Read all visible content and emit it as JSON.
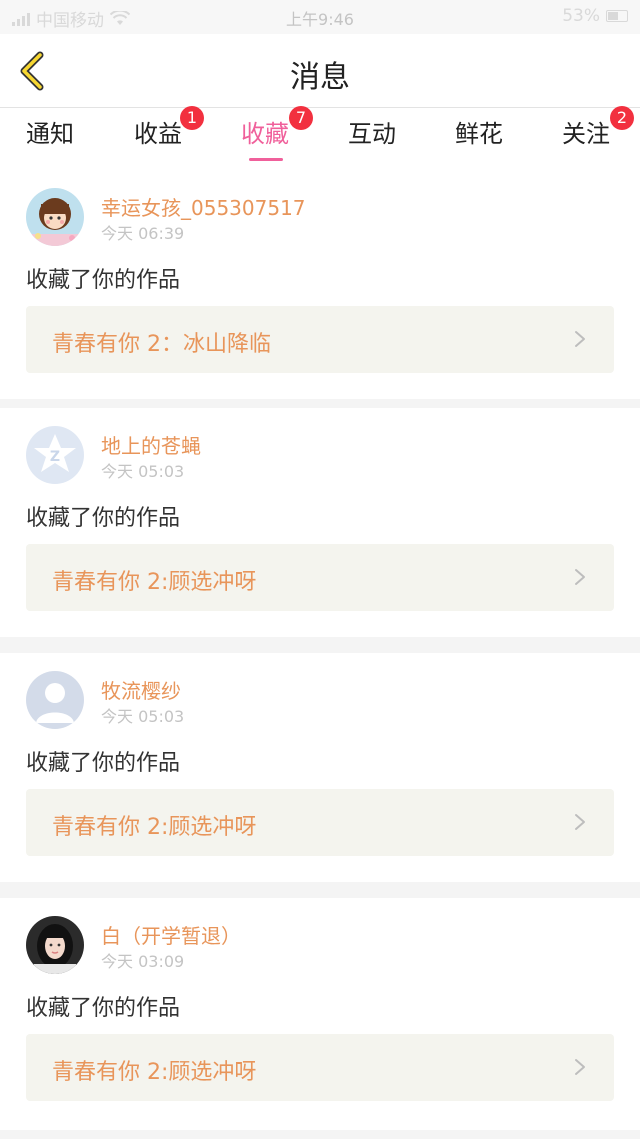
{
  "status_bar": {
    "carrier": "中国移动",
    "time": "上午9:46",
    "battery": "53%"
  },
  "header": {
    "title": "消息"
  },
  "tabs": [
    {
      "label": "通知",
      "badge": ""
    },
    {
      "label": "收益",
      "badge": "1"
    },
    {
      "label": "收藏",
      "badge": "7"
    },
    {
      "label": "互动",
      "badge": ""
    },
    {
      "label": "鲜花",
      "badge": ""
    },
    {
      "label": "关注",
      "badge": "2"
    }
  ],
  "active_tab": "收藏",
  "colors": {
    "accent_pink": "#f0609b",
    "username_orange": "#e8955a",
    "badge_red": "#f2303f"
  },
  "messages": [
    {
      "username": "幸运女孩_055307517",
      "time": "今天 06:39",
      "action": "收藏了你的作品",
      "work_title": "青春有你 2：冰山降临",
      "avatar_icon": "cartoon-girl-avatar"
    },
    {
      "username": "地上的苍蝇",
      "time": "今天 05:03",
      "action": "收藏了你的作品",
      "work_title": "青春有你 2:顾选冲呀",
      "avatar_icon": "qq-default-avatar"
    },
    {
      "username": "牧流樱纱",
      "time": "今天 05:03",
      "action": "收藏了你的作品",
      "work_title": "青春有你 2:顾选冲呀",
      "avatar_icon": "default-person-avatar"
    },
    {
      "username": "白（开学暂退）",
      "time": "今天 03:09",
      "action": "收藏了你的作品",
      "work_title": "青春有你 2:顾选冲呀",
      "avatar_icon": "photo-girl-avatar"
    }
  ]
}
